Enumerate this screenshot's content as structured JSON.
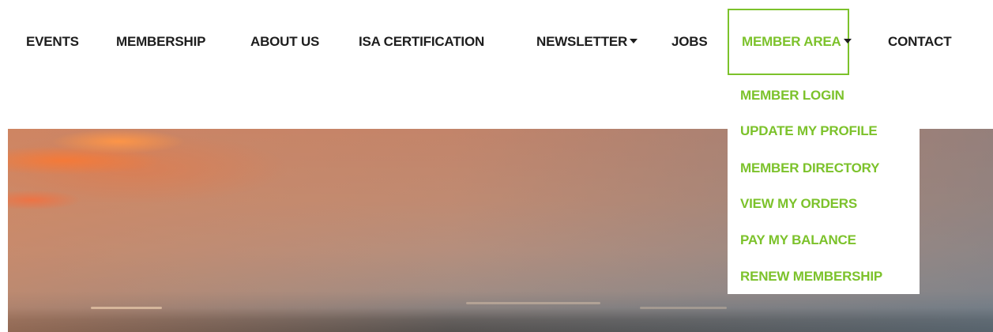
{
  "nav": {
    "items": [
      {
        "label": "EVENTS"
      },
      {
        "label": "MEMBERSHIP"
      },
      {
        "label": "ABOUT US"
      },
      {
        "label": "ISA CERTIFICATION"
      },
      {
        "label": "NEWSLETTER"
      },
      {
        "label": "JOBS"
      },
      {
        "label": "MEMBER AREA"
      },
      {
        "label": "CONTACT"
      }
    ],
    "active_color": "#7cc22b",
    "text_color": "#1d1d1d"
  },
  "dropdown": {
    "items": [
      {
        "label": "MEMBER LOGIN"
      },
      {
        "label": "UPDATE MY PROFILE"
      },
      {
        "label": "MEMBER DIRECTORY"
      },
      {
        "label": "VIEW MY ORDERS"
      },
      {
        "label": "PAY MY BALANCE"
      },
      {
        "label": "RENEW MEMBERSHIP"
      }
    ]
  },
  "icons": {
    "dropdown_caret": "caret-down-icon"
  }
}
